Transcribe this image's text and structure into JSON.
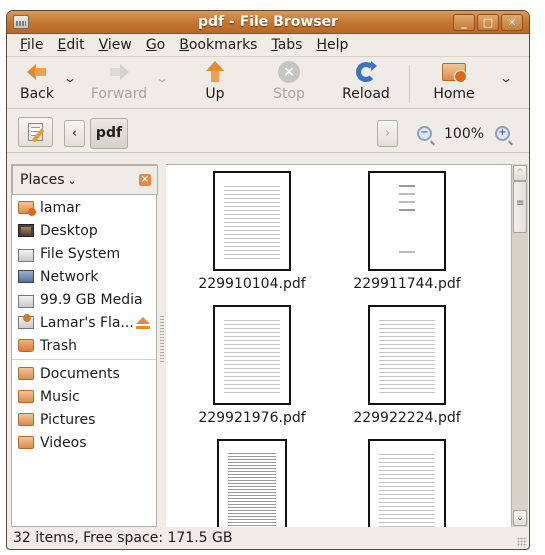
{
  "window": {
    "title": "pdf - File Browser",
    "controls": {
      "minimize": "_",
      "maximize": "□",
      "close": "✕"
    }
  },
  "menubar": {
    "items": [
      {
        "label": "File",
        "mnemonic": "F"
      },
      {
        "label": "Edit",
        "mnemonic": "E"
      },
      {
        "label": "View",
        "mnemonic": "V"
      },
      {
        "label": "Go",
        "mnemonic": "G"
      },
      {
        "label": "Bookmarks",
        "mnemonic": "B"
      },
      {
        "label": "Tabs",
        "mnemonic": "T"
      },
      {
        "label": "Help",
        "mnemonic": "H"
      }
    ]
  },
  "toolbar": {
    "back_label": "Back",
    "forward_label": "Forward",
    "up_label": "Up",
    "stop_label": "Stop",
    "reload_label": "Reload",
    "home_label": "Home",
    "dropdown_glyph": "⌄",
    "forward_enabled": false,
    "stop_enabled": false
  },
  "locationbar": {
    "prev_glyph": "‹",
    "next_glyph": "›",
    "current_path": "pdf",
    "zoom_out_glyph": "−",
    "zoom_in_glyph": "+",
    "zoom_level": "100%"
  },
  "sidebar": {
    "header_label": "Places",
    "header_chevron": "⌄",
    "close_glyph": "×",
    "places": [
      {
        "label": "lamar",
        "icon": "home-folder-icon"
      },
      {
        "label": "Desktop",
        "icon": "desktop-icon"
      },
      {
        "label": "File System",
        "icon": "drive-icon"
      },
      {
        "label": "Network",
        "icon": "network-icon"
      },
      {
        "label": "99.9 GB Media",
        "icon": "drive-icon"
      },
      {
        "label": "Lamar's Fla...",
        "icon": "flash-drive-icon",
        "ejectable": true
      },
      {
        "label": "Trash",
        "icon": "trash-icon"
      }
    ],
    "bookmarks": [
      {
        "label": "Documents",
        "icon": "folder-icon"
      },
      {
        "label": "Music",
        "icon": "folder-icon"
      },
      {
        "label": "Pictures",
        "icon": "folder-icon"
      },
      {
        "label": "Videos",
        "icon": "folder-icon"
      }
    ]
  },
  "files": [
    {
      "name": "229910104.pdf",
      "thumb": "text"
    },
    {
      "name": "229911744.pdf",
      "thumb": "title-page"
    },
    {
      "name": "229921976.pdf",
      "thumb": "text"
    },
    {
      "name": "229922224.pdf",
      "thumb": "text"
    },
    {
      "name": "",
      "thumb": "dense"
    },
    {
      "name": "",
      "thumb": "invoice"
    }
  ],
  "statusbar": {
    "text": "32 items, Free space: 171.5 GB"
  }
}
